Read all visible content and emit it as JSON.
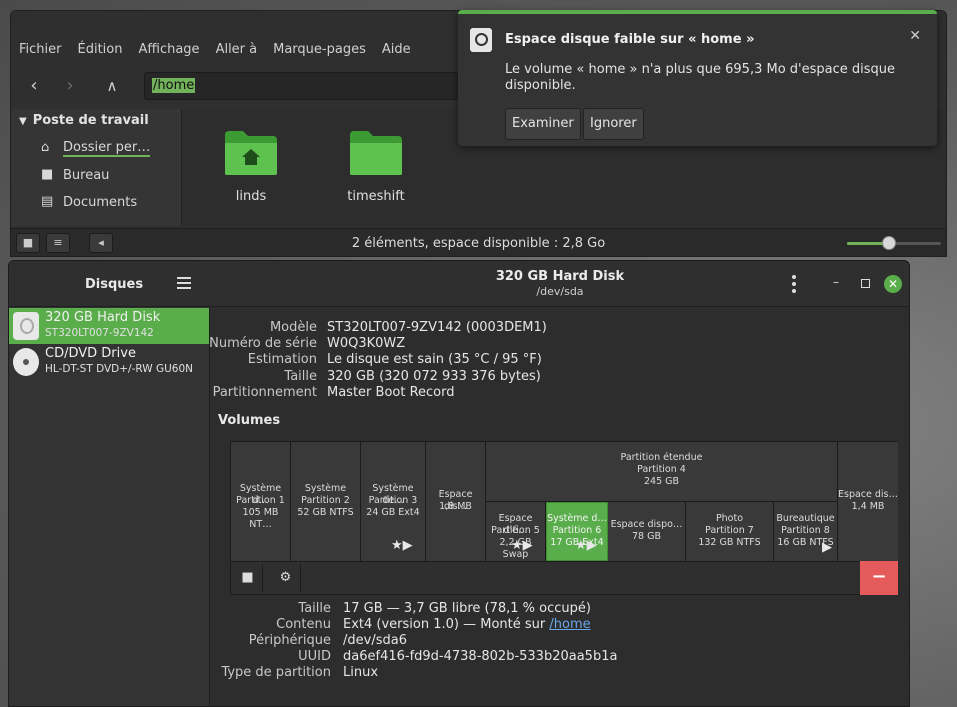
{
  "file_manager": {
    "menu": [
      "Fichier",
      "Édition",
      "Affichage",
      "Aller à",
      "Marque-pages",
      "Aide"
    ],
    "location": "/home",
    "sidebar": {
      "heading": "Poste de travail",
      "items": [
        "Dossier per…",
        "Bureau",
        "Documents"
      ]
    },
    "folders": [
      "linds",
      "timeshift"
    ],
    "status": "2 éléments, espace disponible : 2,8 Go",
    "zoom_level": 0.45
  },
  "notification": {
    "title": "Espace disque faible sur « home »",
    "body": "Le volume « home » n'a plus que 695,3 Mo d'espace disque disponible.",
    "buttons": [
      "Examiner",
      "Ignorer"
    ],
    "accent": "#5aad4b"
  },
  "disks": {
    "title": "Disques",
    "drives": [
      {
        "name": "320 GB Hard Disk",
        "model": "ST320LT007-9ZV142",
        "selected": true
      },
      {
        "name": "CD/DVD Drive",
        "model": "HL-DT-ST DVD+/-RW GU60N",
        "selected": false
      }
    ],
    "header": {
      "title": "320 GB Hard Disk",
      "subtitle": "/dev/sda"
    },
    "info": [
      {
        "key": "Modèle",
        "value": "ST320LT007-9ZV142 (0003DEM1)"
      },
      {
        "key": "Numéro de série",
        "value": "W0Q3K0WZ"
      },
      {
        "key": "Estimation",
        "value": "Le disque est sain (35 °C / 95 °F)"
      },
      {
        "key": "Taille",
        "value": "320 GB (320 072 933 376 bytes)"
      },
      {
        "key": "Partitionnement",
        "value": "Master Boot Record"
      }
    ],
    "volumes_title": "Volumes",
    "partitions": {
      "p1": [
        "Système d…",
        "Partition 1",
        "105 MB NT…"
      ],
      "p2": [
        "Système",
        "Partition 2",
        "52 GB NTFS"
      ],
      "p3": [
        "Système de…",
        "Partition 3",
        "24 GB Ext4"
      ],
      "free1": [
        "Espace dis…",
        "1,8 MB"
      ],
      "extended": [
        "Partition étendue",
        "Partition 4",
        "245 GB"
      ],
      "p5": [
        "Espace d'é…",
        "Partition 5",
        "2,2 GB Swap"
      ],
      "p6": [
        "Système d…",
        "Partition 6",
        "17 GB Ext4"
      ],
      "free2": [
        "Espace dispo…",
        "78 GB"
      ],
      "p7": [
        "Photo",
        "Partition 7",
        "132 GB NTFS"
      ],
      "p8": [
        "Bureautique",
        "Partition 8",
        "16 GB NTFS"
      ],
      "free3": [
        "Espace dis…",
        "1,4 MB"
      ]
    },
    "volume_details": [
      {
        "key": "Taille",
        "value": "17 GB — 3,7 GB libre (78,1 % occupé)"
      },
      {
        "key": "Contenu",
        "value": "Ext4 (version 1.0) — Monté sur ",
        "link": "/home"
      },
      {
        "key": "Périphérique",
        "value": "/dev/sda6"
      },
      {
        "key": "UUID",
        "value": "da6ef416-fd9d-4738-802b-533b20aa5b1a"
      },
      {
        "key": "Type de partition",
        "value": "Linux"
      }
    ],
    "accent": "#5aad4b",
    "danger": "#e55b5b"
  }
}
